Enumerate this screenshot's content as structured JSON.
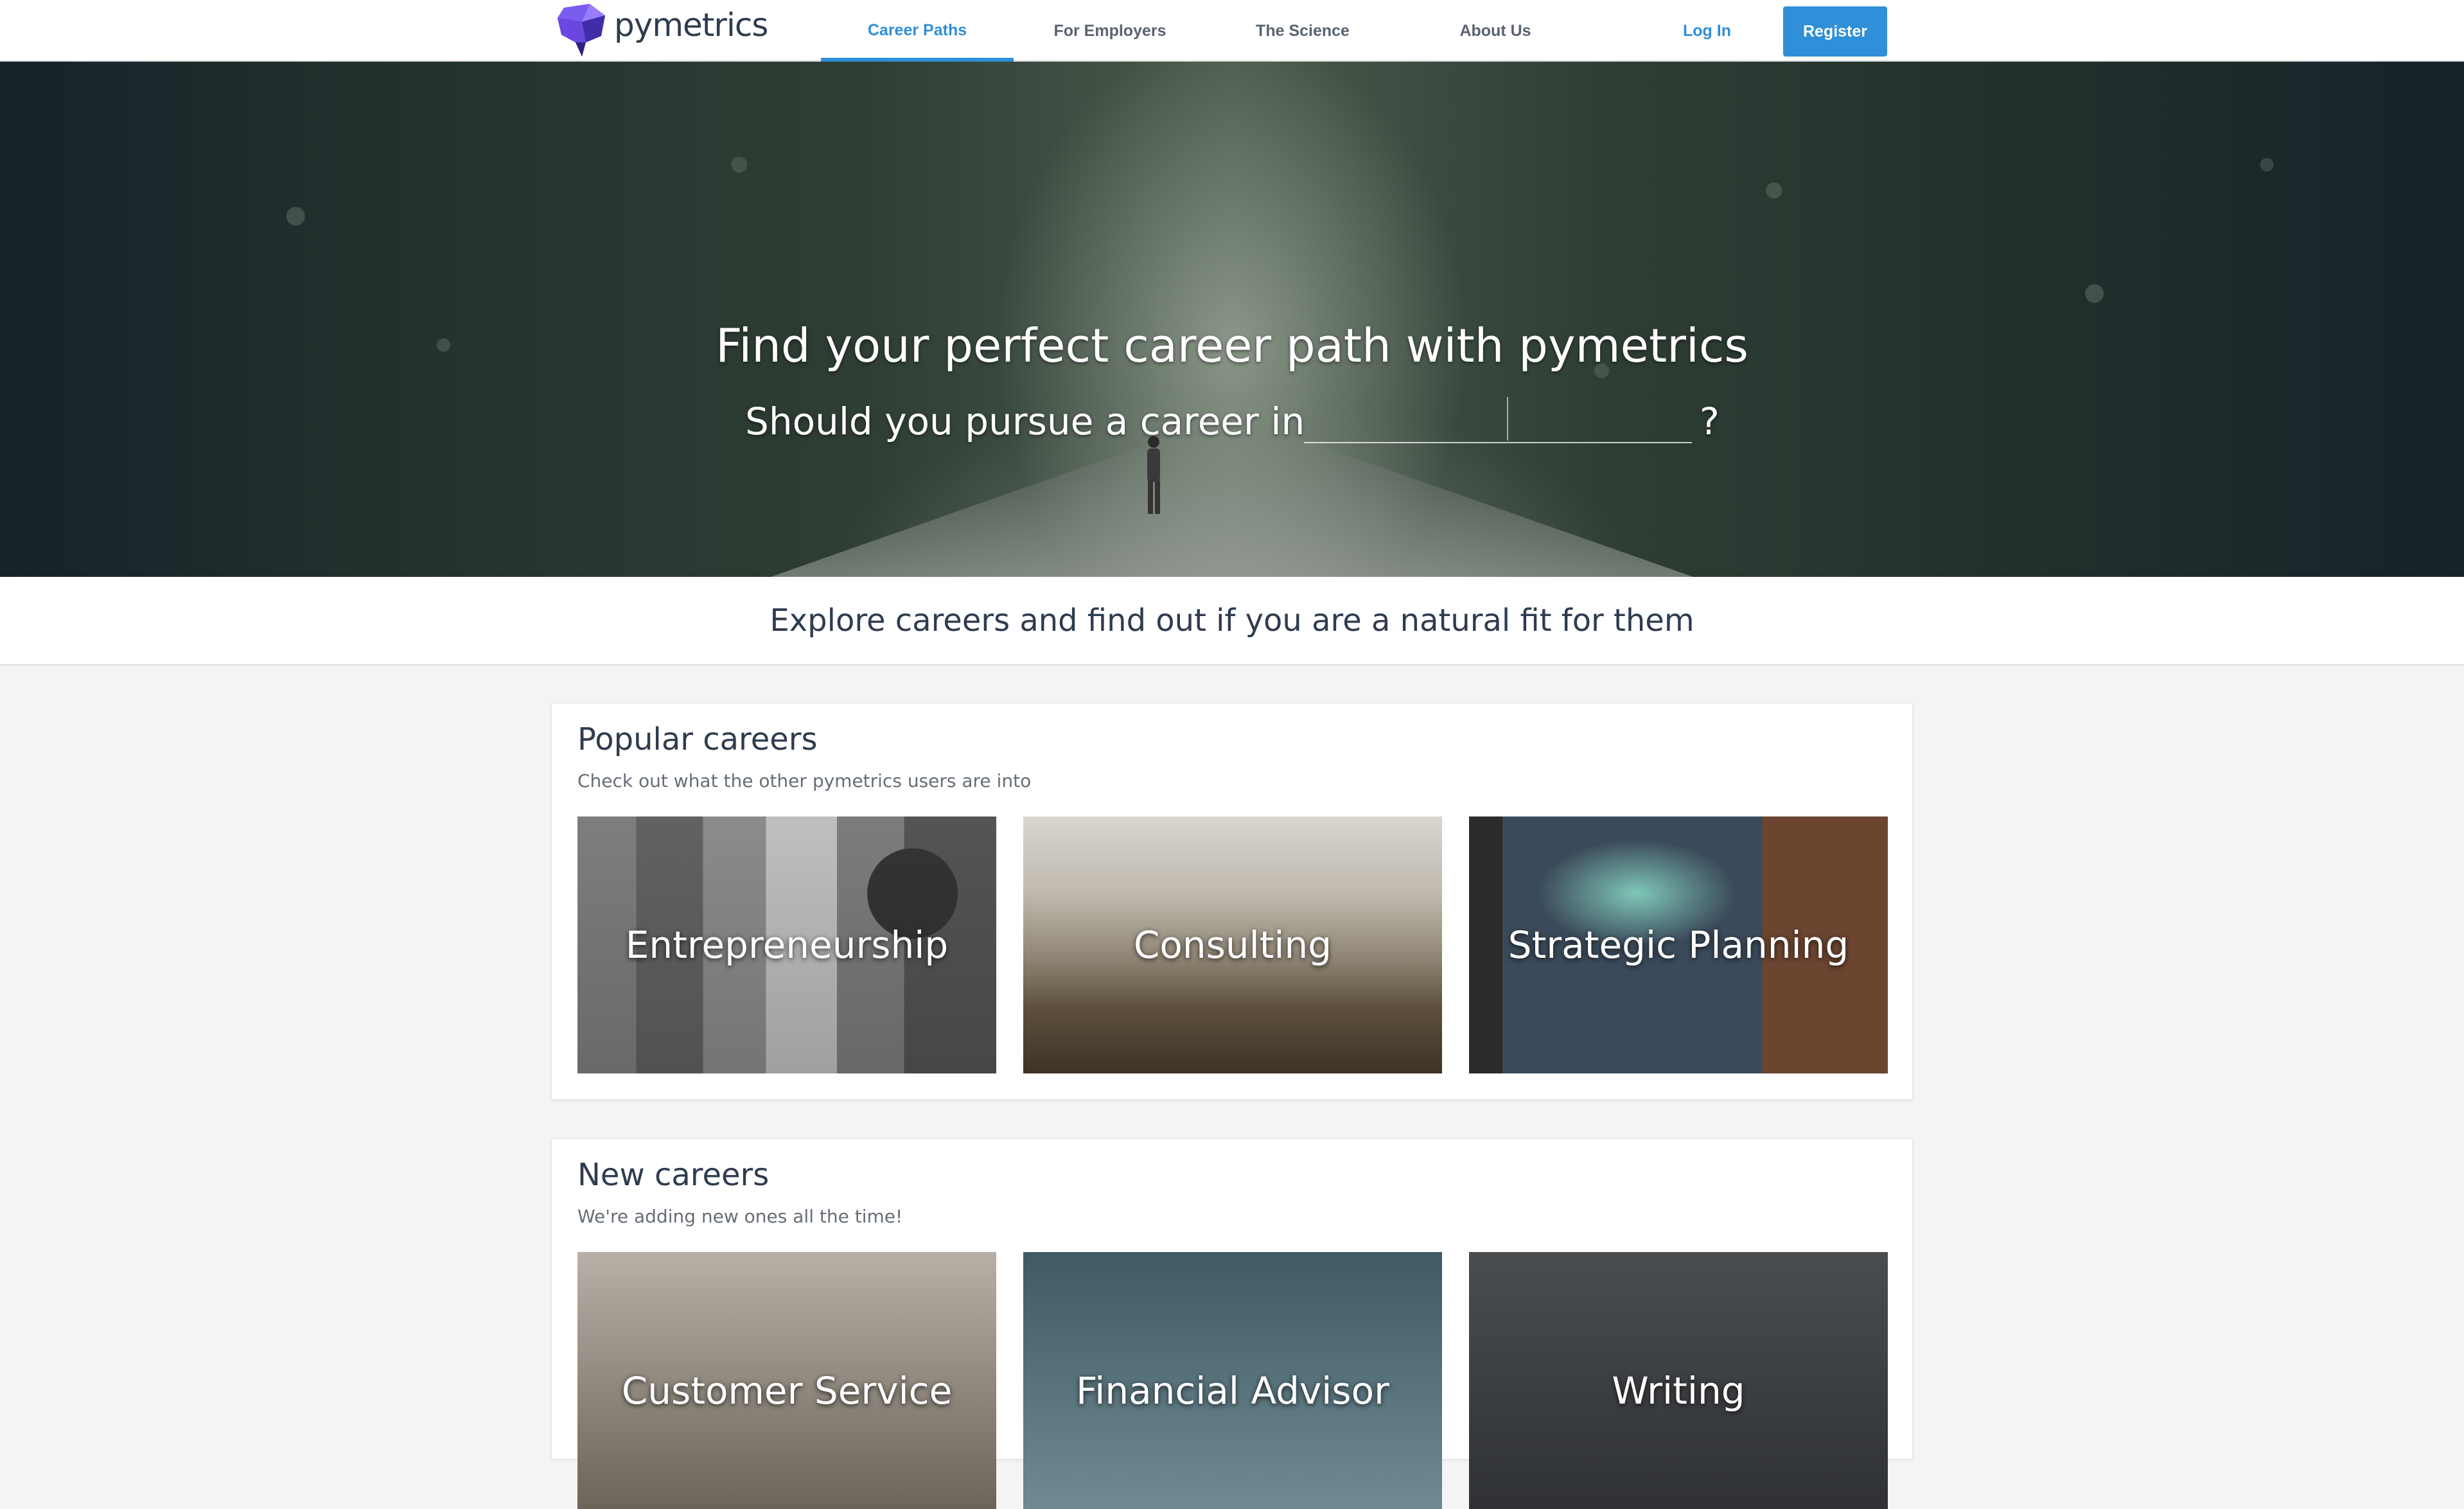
{
  "brand": {
    "name": "pymetrics",
    "logo_icon": "purple-head-logo-icon",
    "accent": "#2f8fd8"
  },
  "nav": {
    "items": [
      {
        "label": "Career Paths",
        "active": true
      },
      {
        "label": "For Employers",
        "active": false
      },
      {
        "label": "The Science",
        "active": false
      },
      {
        "label": "About Us",
        "active": false
      }
    ],
    "login": "Log In",
    "register": "Register"
  },
  "hero": {
    "title": "Find your perfect career path with pymetrics",
    "prompt": "Should you pursue a career in",
    "input_value": "",
    "input_placeholder": "",
    "suffix": "?"
  },
  "explore": {
    "text": "Explore careers and find out if you are a natural fit for them"
  },
  "popular": {
    "title": "Popular careers",
    "subtitle": "Check out what the other pymetrics users are into",
    "tiles": [
      "Entrepreneurship",
      "Consulting",
      "Strategic Planning"
    ]
  },
  "new": {
    "title": "New careers",
    "subtitle": "We're adding new ones all the time!",
    "tiles": [
      "Customer Service",
      "Financial Advisor",
      "Writing"
    ]
  }
}
